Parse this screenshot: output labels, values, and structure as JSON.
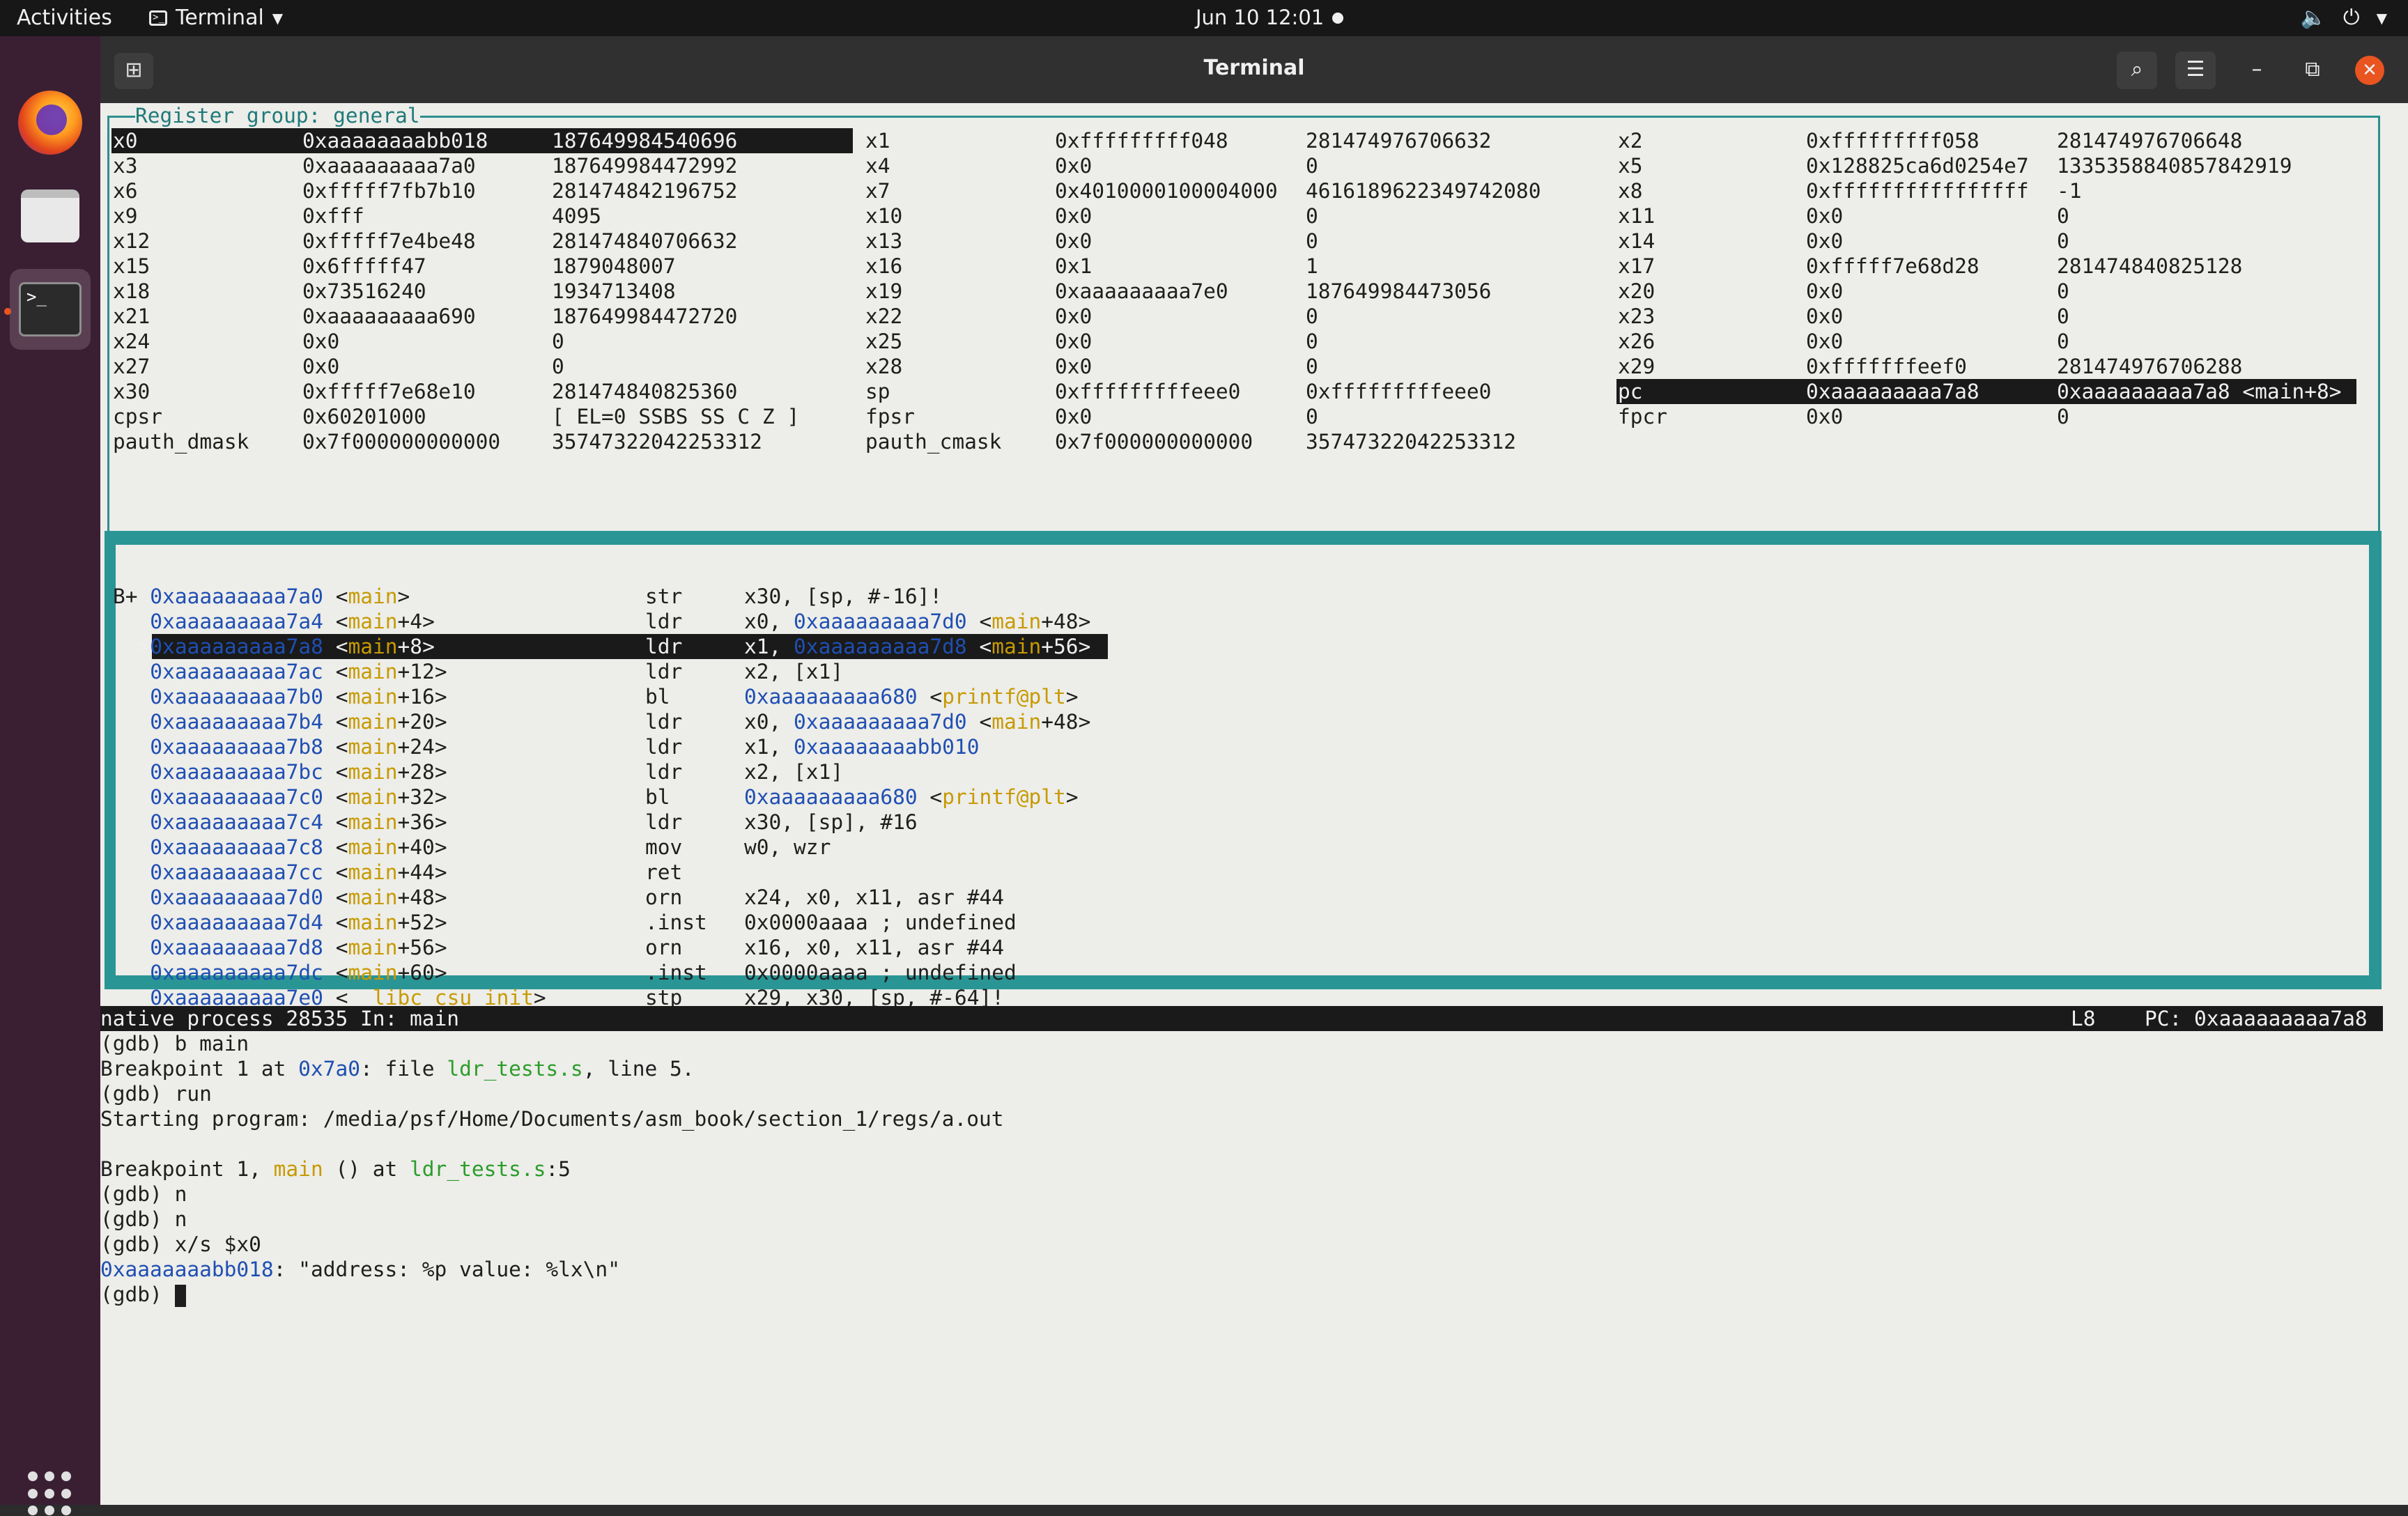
{
  "topbar": {
    "activities": "Activities",
    "app_name": "Terminal",
    "clock": "Jun 10  12:01"
  },
  "window": {
    "title": "Terminal"
  },
  "registers": {
    "group_title": "Register group: general",
    "rows": [
      [
        [
          "x0",
          "0xaaaaaaaabb018",
          "187649984540696"
        ],
        [
          "x1",
          "0xfffffffff048",
          "281474976706632"
        ],
        [
          "x2",
          "0xfffffffff058",
          "281474976706648"
        ]
      ],
      [
        [
          "x3",
          "0xaaaaaaaaa7a0",
          "187649984472992"
        ],
        [
          "x4",
          "0x0",
          "0"
        ],
        [
          "x5",
          "0x128825ca6d0254e7",
          "1335358840857842919"
        ]
      ],
      [
        [
          "x6",
          "0xfffff7fb7b10",
          "281474842196752"
        ],
        [
          "x7",
          "0x4010000100004000",
          "4616189622349742080"
        ],
        [
          "x8",
          "0xffffffffffffffff",
          "-1"
        ]
      ],
      [
        [
          "x9",
          "0xfff",
          "4095"
        ],
        [
          "x10",
          "0x0",
          "0"
        ],
        [
          "x11",
          "0x0",
          "0"
        ]
      ],
      [
        [
          "x12",
          "0xfffff7e4be48",
          "281474840706632"
        ],
        [
          "x13",
          "0x0",
          "0"
        ],
        [
          "x14",
          "0x0",
          "0"
        ]
      ],
      [
        [
          "x15",
          "0x6fffff47",
          "1879048007"
        ],
        [
          "x16",
          "0x1",
          "1"
        ],
        [
          "x17",
          "0xfffff7e68d28",
          "281474840825128"
        ]
      ],
      [
        [
          "x18",
          "0x73516240",
          "1934713408"
        ],
        [
          "x19",
          "0xaaaaaaaaa7e0",
          "187649984473056"
        ],
        [
          "x20",
          "0x0",
          "0"
        ]
      ],
      [
        [
          "x21",
          "0xaaaaaaaaa690",
          "187649984472720"
        ],
        [
          "x22",
          "0x0",
          "0"
        ],
        [
          "x23",
          "0x0",
          "0"
        ]
      ],
      [
        [
          "x24",
          "0x0",
          "0"
        ],
        [
          "x25",
          "0x0",
          "0"
        ],
        [
          "x26",
          "0x0",
          "0"
        ]
      ],
      [
        [
          "x27",
          "0x0",
          "0"
        ],
        [
          "x28",
          "0x0",
          "0"
        ],
        [
          "x29",
          "0xfffffffeef0",
          "281474976706288"
        ]
      ],
      [
        [
          "x30",
          "0xfffff7e68e10",
          "281474840825360"
        ],
        [
          "sp",
          "0xfffffffffeee0",
          "0xfffffffffeee0"
        ],
        [
          "pc",
          "0xaaaaaaaaa7a8",
          "0xaaaaaaaaa7a8 <main+8>"
        ]
      ],
      [
        [
          "cpsr",
          "0x60201000",
          "[ EL=0 SSBS SS C Z ]"
        ],
        [
          "fpsr",
          "0x0",
          "0"
        ],
        [
          "fpcr",
          "0x0",
          "0"
        ]
      ],
      [
        [
          "pauth_dmask",
          "0x7f000000000000",
          "35747322042253312"
        ],
        [
          "pauth_cmask",
          "0x7f000000000000",
          "35747322042253312"
        ],
        [
          "",
          "",
          ""
        ]
      ]
    ]
  },
  "asm": [
    {
      "marker": "B+ ",
      "addr": "0xaaaaaaaaa7a0",
      "func": "main",
      "off": "",
      "op": "str",
      "args": "x30, [sp, #-16]!"
    },
    {
      "marker": "   ",
      "addr": "0xaaaaaaaaa7a4",
      "func": "main",
      "off": "+4",
      "op": "ldr",
      "args": "x0, ",
      "ref": "0xaaaaaaaaa7d0",
      "ref_func": "main",
      "ref_off": "+48"
    },
    {
      "marker": "  >",
      "addr": "0xaaaaaaaaa7a8",
      "func": "main",
      "off": "+8",
      "op": "ldr",
      "args": "x1, ",
      "ref": "0xaaaaaaaaa7d8",
      "ref_func": "main",
      "ref_off": "+56"
    },
    {
      "marker": "   ",
      "addr": "0xaaaaaaaaa7ac",
      "func": "main",
      "off": "+12",
      "op": "ldr",
      "args": "x2, [x1]"
    },
    {
      "marker": "   ",
      "addr": "0xaaaaaaaaa7b0",
      "func": "main",
      "off": "+16",
      "op": "bl",
      "args": "",
      "ref": "0xaaaaaaaaa680",
      "ref_func": "printf@plt",
      "ref_off": ""
    },
    {
      "marker": "   ",
      "addr": "0xaaaaaaaaa7b4",
      "func": "main",
      "off": "+20",
      "op": "ldr",
      "args": "x0, ",
      "ref": "0xaaaaaaaaa7d0",
      "ref_func": "main",
      "ref_off": "+48"
    },
    {
      "marker": "   ",
      "addr": "0xaaaaaaaaa7b8",
      "func": "main",
      "off": "+24",
      "op": "ldr",
      "args": "x1, ",
      "ref": "0xaaaaaaaabb010"
    },
    {
      "marker": "   ",
      "addr": "0xaaaaaaaaa7bc",
      "func": "main",
      "off": "+28",
      "op": "ldr",
      "args": "x2, [x1]"
    },
    {
      "marker": "   ",
      "addr": "0xaaaaaaaaa7c0",
      "func": "main",
      "off": "+32",
      "op": "bl",
      "args": "",
      "ref": "0xaaaaaaaaa680",
      "ref_func": "printf@plt",
      "ref_off": ""
    },
    {
      "marker": "   ",
      "addr": "0xaaaaaaaaa7c4",
      "func": "main",
      "off": "+36",
      "op": "ldr",
      "args": "x30, [sp], #16"
    },
    {
      "marker": "   ",
      "addr": "0xaaaaaaaaa7c8",
      "func": "main",
      "off": "+40",
      "op": "mov",
      "args": "w0, wzr"
    },
    {
      "marker": "   ",
      "addr": "0xaaaaaaaaa7cc",
      "func": "main",
      "off": "+44",
      "op": "ret",
      "args": ""
    },
    {
      "marker": "   ",
      "addr": "0xaaaaaaaaa7d0",
      "func": "main",
      "off": "+48",
      "op": "orn",
      "args": "x24, x0, x11, asr #44"
    },
    {
      "marker": "   ",
      "addr": "0xaaaaaaaaa7d4",
      "func": "main",
      "off": "+52",
      "op": ".inst",
      "args": "0x0000aaaa ; undefined"
    },
    {
      "marker": "   ",
      "addr": "0xaaaaaaaaa7d8",
      "func": "main",
      "off": "+56",
      "op": "orn",
      "args": "x16, x0, x11, asr #44"
    },
    {
      "marker": "   ",
      "addr": "0xaaaaaaaaa7dc",
      "func": "main",
      "off": "+60",
      "op": ".inst",
      "args": "0x0000aaaa ; undefined"
    },
    {
      "marker": "   ",
      "addr": "0xaaaaaaaaa7e0",
      "func": "__libc_csu_init",
      "off": "",
      "op": "stp",
      "args": "x29, x30, [sp, #-64]!"
    }
  ],
  "status": {
    "left": "native process 28535 In: main",
    "line": "L8",
    "pc": "PC: 0xaaaaaaaaa7a8"
  },
  "console": {
    "l1": "(gdb) b main",
    "l2_a": "Breakpoint 1 at ",
    "l2_addr": "0x7a0",
    "l2_b": ": file ",
    "l2_file": "ldr_tests.s",
    "l2_c": ", line 5.",
    "l3": "(gdb) run",
    "l4": "Starting program: /media/psf/Home/Documents/asm_book/section_1/regs/a.out",
    "l6_a": "Breakpoint 1, ",
    "l6_func": "main",
    "l6_b": " () at ",
    "l6_file": "ldr_tests.s",
    "l6_c": ":5",
    "l7": "(gdb) n",
    "l8": "(gdb) n",
    "l9": "(gdb) x/s $x0",
    "l10_addr": "0xaaaaaaabb018",
    "l10_b": ": \"address: %p value: %lx\\n\"",
    "l11": "(gdb) "
  }
}
